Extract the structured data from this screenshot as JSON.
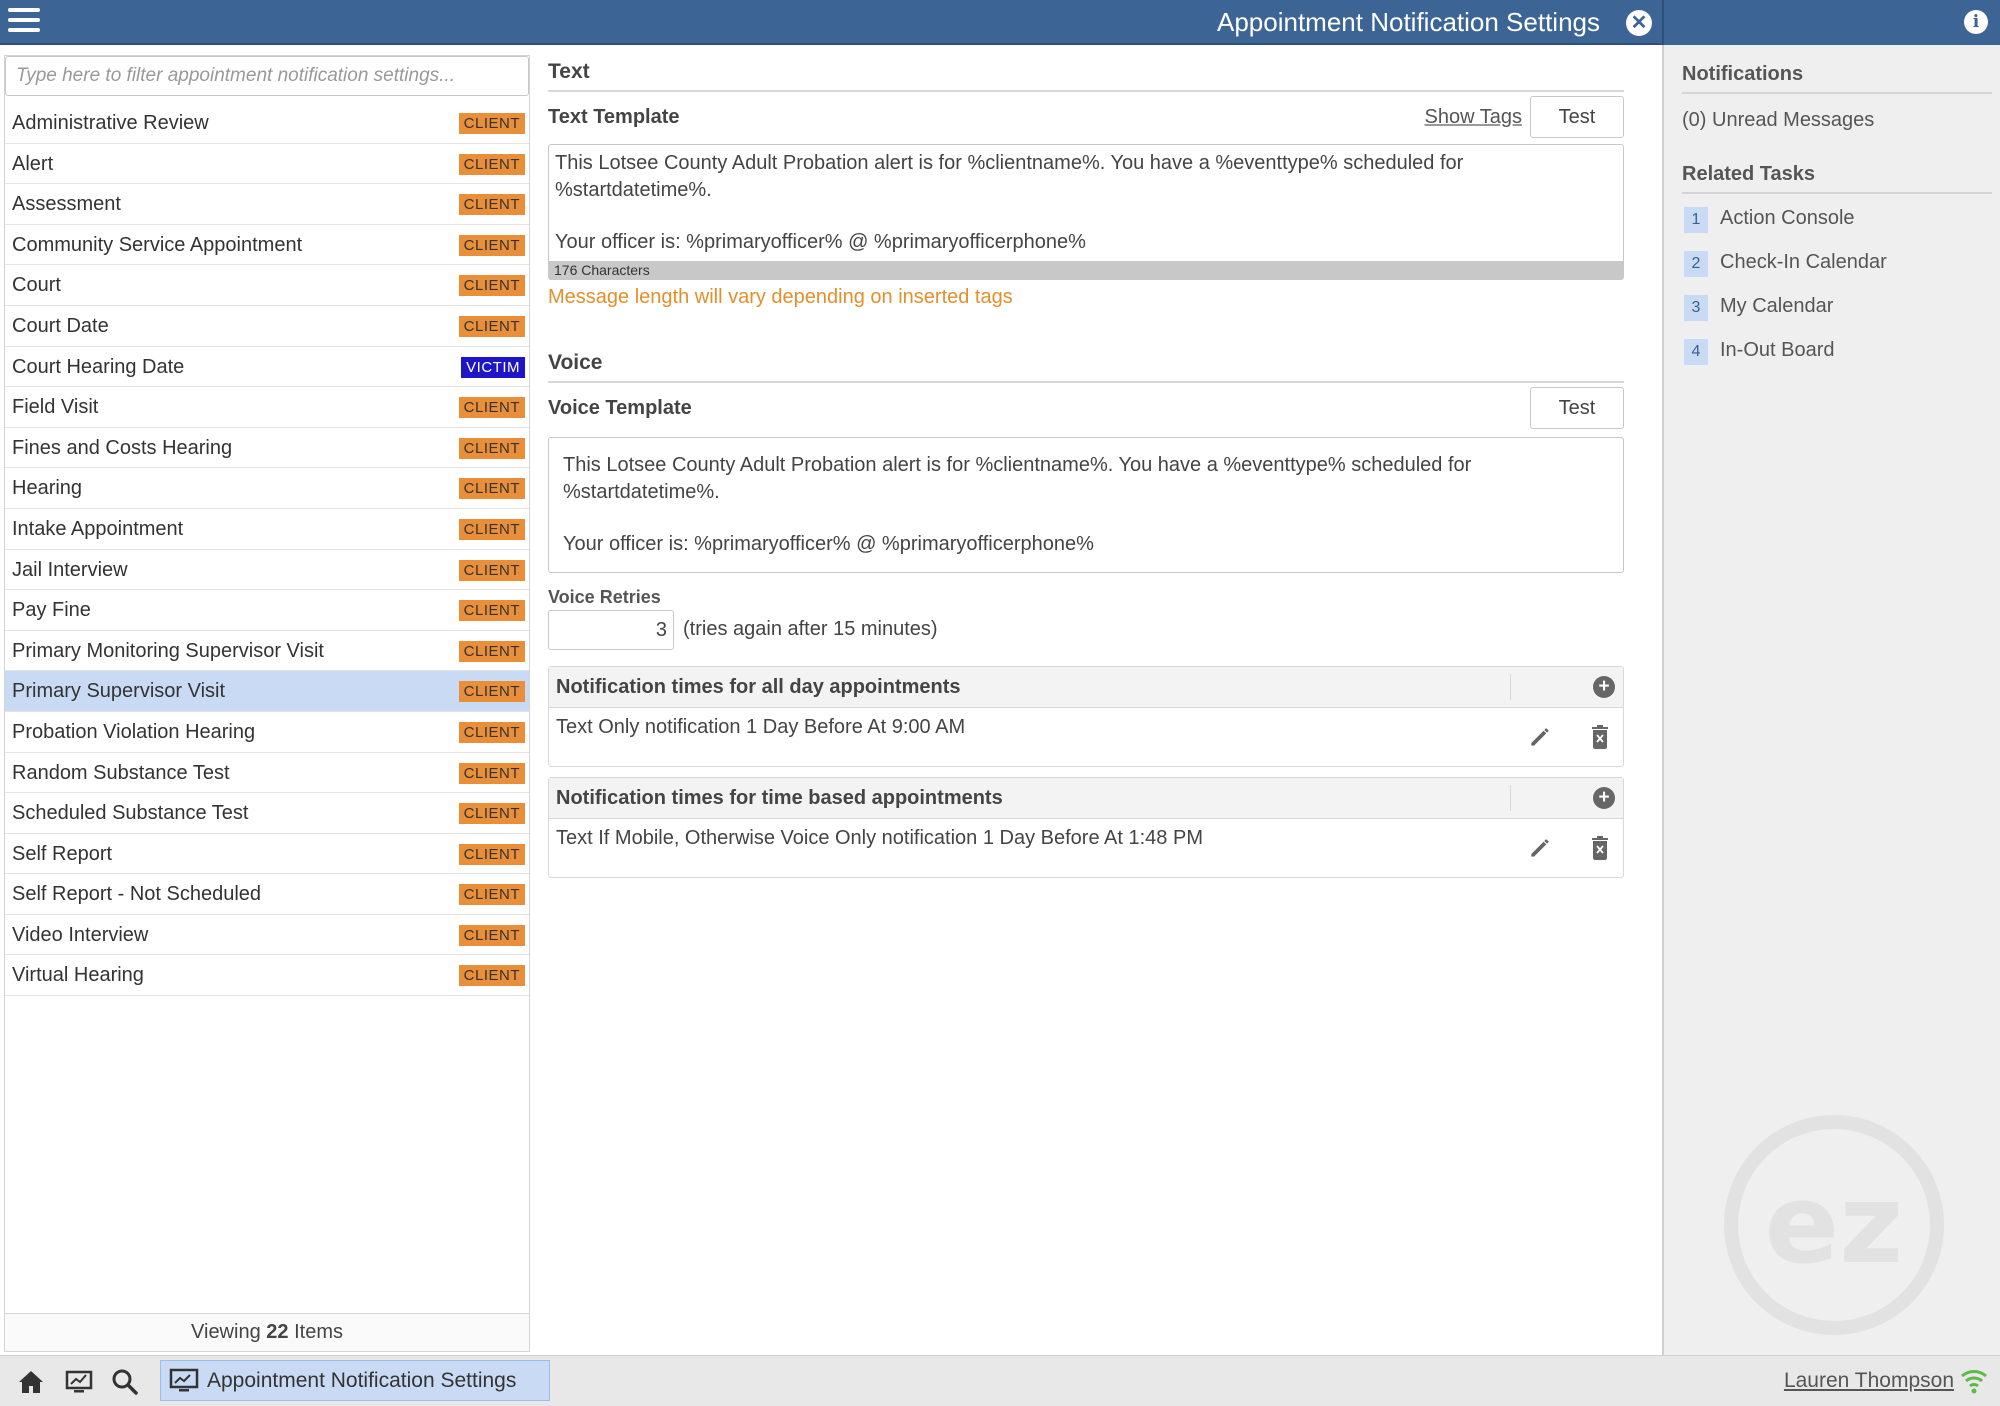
{
  "header": {
    "title": "Appointment Notification Settings",
    "menu_icon": "hamburger-icon",
    "close_icon": "close-icon",
    "info_icon": "info-icon"
  },
  "sidebar": {
    "filter_placeholder": "Type here to filter appointment notification settings...",
    "items": [
      {
        "label": "Administrative Review",
        "badge": "CLIENT"
      },
      {
        "label": "Alert",
        "badge": "CLIENT"
      },
      {
        "label": "Assessment",
        "badge": "CLIENT"
      },
      {
        "label": "Community Service Appointment",
        "badge": "CLIENT"
      },
      {
        "label": "Court",
        "badge": "CLIENT"
      },
      {
        "label": "Court Date",
        "badge": "CLIENT"
      },
      {
        "label": "Court Hearing Date",
        "badge": "VICTIM"
      },
      {
        "label": "Field Visit",
        "badge": "CLIENT"
      },
      {
        "label": "Fines and Costs Hearing",
        "badge": "CLIENT"
      },
      {
        "label": "Hearing",
        "badge": "CLIENT"
      },
      {
        "label": "Intake Appointment",
        "badge": "CLIENT"
      },
      {
        "label": "Jail Interview",
        "badge": "CLIENT"
      },
      {
        "label": "Pay Fine",
        "badge": "CLIENT"
      },
      {
        "label": "Primary Monitoring Supervisor Visit",
        "badge": "CLIENT"
      },
      {
        "label": "Primary Supervisor Visit",
        "badge": "CLIENT"
      },
      {
        "label": "Probation Violation Hearing",
        "badge": "CLIENT"
      },
      {
        "label": "Random Substance Test",
        "badge": "CLIENT"
      },
      {
        "label": "Scheduled Substance Test",
        "badge": "CLIENT"
      },
      {
        "label": "Self Report",
        "badge": "CLIENT"
      },
      {
        "label": "Self Report - Not Scheduled",
        "badge": "CLIENT"
      },
      {
        "label": "Video Interview",
        "badge": "CLIENT"
      },
      {
        "label": "Virtual Hearing",
        "badge": "CLIENT"
      }
    ],
    "selected_label": "Primary Supervisor Visit",
    "footer_prefix": "Viewing",
    "footer_count": "22",
    "footer_suffix": "Items",
    "badge_colors": {
      "CLIENT": "#e98f3a",
      "VICTIM": "#1f15c8"
    }
  },
  "text_section": {
    "title": "Text",
    "template_label": "Text Template",
    "show_tags_label": "Show Tags",
    "test_label": "Test",
    "template_line1": "This Lotsee County Adult Probation alert is for %clientname%. You have a %eventtype% scheduled for %startdatetime%.",
    "template_line2": "Your officer is: %primaryofficer% @ %primaryofficerphone%",
    "char_count": "176 Characters",
    "warning": "Message length will vary depending on inserted tags"
  },
  "voice_section": {
    "title": "Voice",
    "template_label": "Voice Template",
    "test_label": "Test",
    "template_line1": "This Lotsee County Adult Probation alert is for %clientname%. You have a %eventtype% scheduled for %startdatetime%.",
    "template_line2": "Your officer is: %primaryofficer% @ %primaryofficerphone%",
    "retries_label": "Voice Retries",
    "retries_value": "3",
    "retries_note": "(tries again after 15 minutes)"
  },
  "notification_tables": {
    "all_day": {
      "header": "Notification times for all day appointments",
      "row": "Text Only notification 1 Day Before At 9:00 AM"
    },
    "time_based": {
      "header": "Notification times for time based appointments",
      "row": "Text If Mobile, Otherwise Voice Only notification 1 Day Before At 1:48 PM"
    }
  },
  "right_panel": {
    "notifications_title": "Notifications",
    "unread": "(0) Unread Messages",
    "related_title": "Related Tasks",
    "tasks": [
      {
        "num": "1",
        "label": "Action Console"
      },
      {
        "num": "2",
        "label": "Check-In Calendar"
      },
      {
        "num": "3",
        "label": "My Calendar"
      },
      {
        "num": "4",
        "label": "In-Out Board"
      }
    ],
    "watermark": "ez"
  },
  "taskbar": {
    "active_task": "Appointment Notification Settings",
    "user": "Lauren Thompson",
    "icons": [
      "home-icon",
      "dashboard-icon",
      "search-icon"
    ]
  },
  "colors": {
    "header_blue": "#3c6494",
    "selected_row": "#c9dbf4",
    "warning_orange": "#e48f2a"
  }
}
